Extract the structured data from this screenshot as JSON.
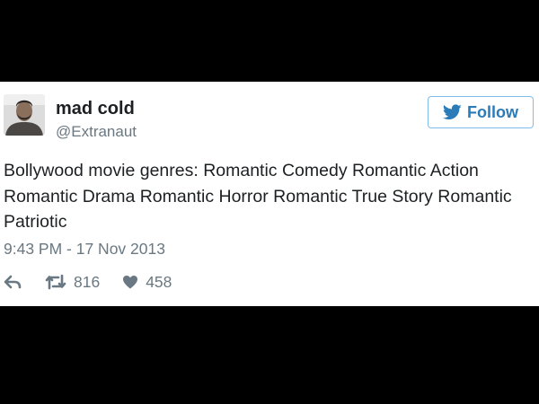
{
  "tweet": {
    "user": {
      "display_name": "mad cold",
      "handle": "@Extranaut"
    },
    "follow_label": "Follow",
    "text": "Bollywood movie genres: Romantic Comedy Romantic Action Romantic Drama Romantic Horror Romantic True Story Romantic Patriotic",
    "timestamp": "9:43 PM - 17 Nov 2013",
    "actions": {
      "reply_icon": "reply-icon",
      "retweet_icon": "retweet-icon",
      "retweet_count": "816",
      "like_icon": "heart-icon",
      "like_count": "458"
    }
  },
  "colors": {
    "background": "#000000",
    "card": "#ffffff",
    "text_primary": "#1c2022",
    "text_secondary": "#697882",
    "twitter_blue": "#2b7bb9",
    "follow_border": "#7fbce9"
  }
}
